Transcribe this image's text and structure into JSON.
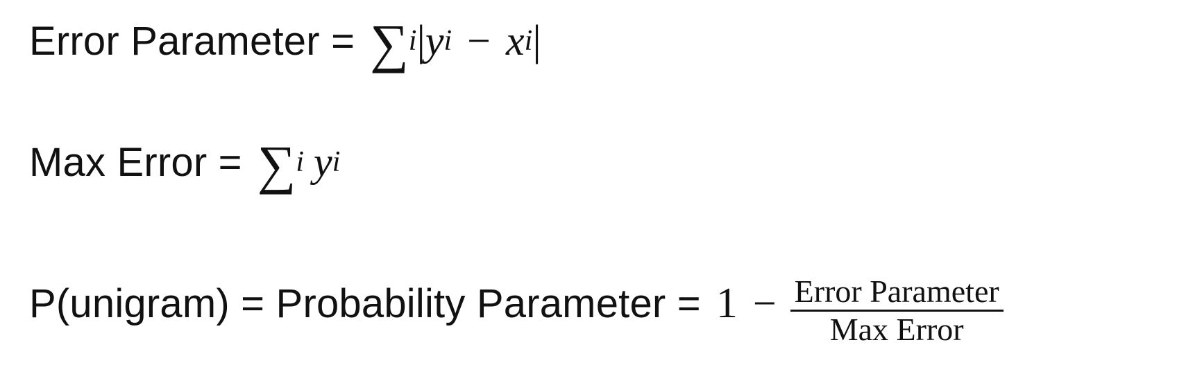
{
  "lines": [
    {
      "label": "Error Parameter =",
      "sigma": "∑",
      "sub_i": "i",
      "bar_left": "|",
      "y": "y",
      "y_sub": "i",
      "minus": "−",
      "x": "x",
      "x_sub": "i",
      "bar_right": "|"
    },
    {
      "label": "Max Error =",
      "sigma": "∑",
      "sub_i": "i",
      "y": "y",
      "y_sub": "i"
    },
    {
      "label": "P(unigram) = Probability Parameter =",
      "one": "1",
      "minus": "−",
      "numerator": "Error Parameter",
      "denominator": "Max Error"
    }
  ]
}
